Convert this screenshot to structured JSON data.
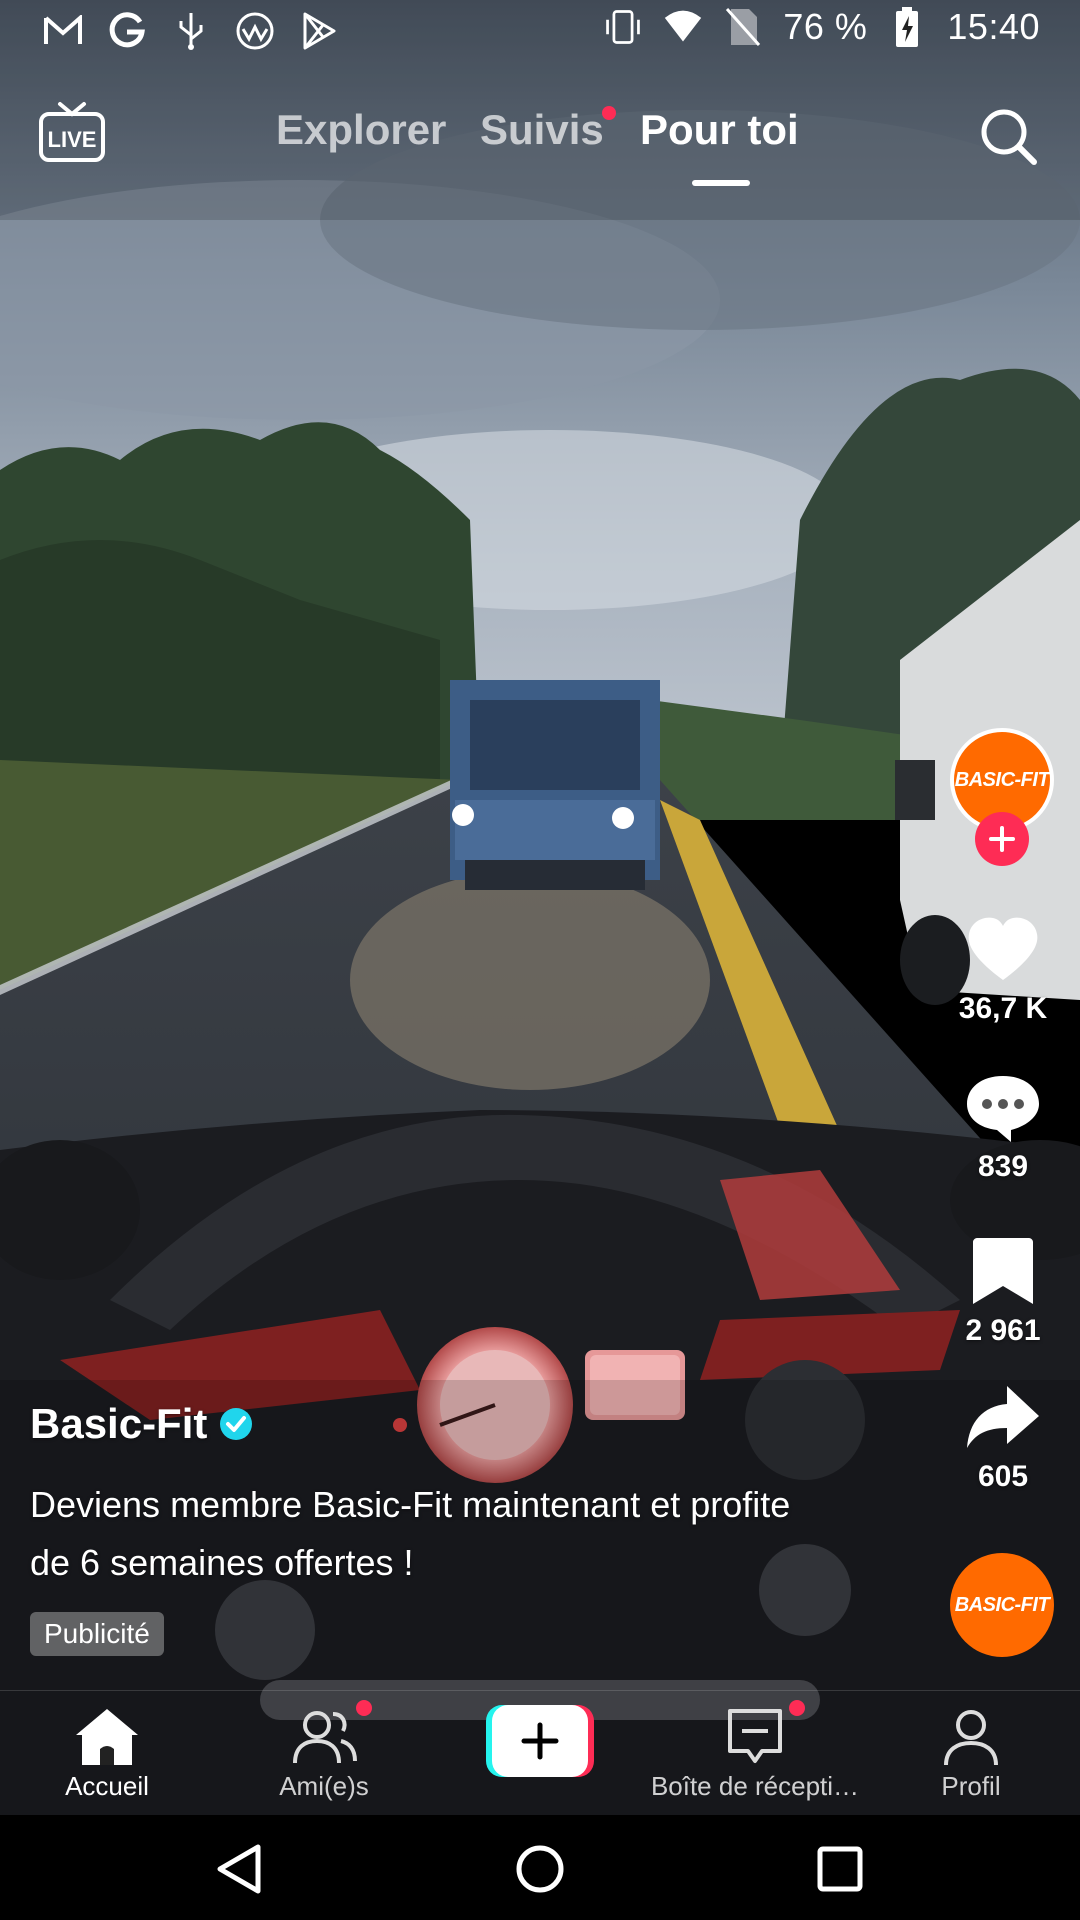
{
  "status_bar": {
    "left_icons": [
      "gmail-icon",
      "google-icon",
      "usb-icon",
      "wifi-app-icon",
      "play-store-icon"
    ],
    "right_icons": [
      "vibrate-icon",
      "wifi-icon",
      "no-sim-icon",
      "battery-charging-icon"
    ],
    "battery": "76 %",
    "time": "15:40"
  },
  "top_nav": {
    "live_icon": "live-tv-icon",
    "live_label": "LIVE",
    "tabs": [
      {
        "label": "Explorer",
        "active": false
      },
      {
        "label": "Suivis",
        "active": false,
        "dot": true
      },
      {
        "label": "Pour toi",
        "active": true
      }
    ],
    "search_icon": "search-icon"
  },
  "actions": {
    "avatar_label": "BASIC-FIT",
    "likes": "36,7 K",
    "comments": "839",
    "saves": "2 961",
    "shares": "605",
    "music_label": "BASIC-FIT"
  },
  "post": {
    "author": "Basic-Fit",
    "verified": true,
    "caption": "Deviens membre Basic-Fit maintenant et profite de 6 semaines offertes !",
    "badge": "Publicité"
  },
  "bottom_nav": {
    "items": [
      {
        "label": "Accueil",
        "icon": "home-icon",
        "active": true
      },
      {
        "label": "Ami(e)s",
        "icon": "friends-icon",
        "dot": true
      },
      {
        "label": "",
        "icon": "create-plus-icon"
      },
      {
        "label": "Boîte de récepti…",
        "icon": "inbox-icon",
        "dot": true
      },
      {
        "label": "Profil",
        "icon": "profile-icon"
      }
    ]
  },
  "system_nav": [
    "back-icon",
    "home-circle-icon",
    "recents-icon"
  ],
  "colors": {
    "accent": "#fe2c55",
    "brand_orange": "#ff6a00",
    "verified": "#20d5ec"
  }
}
